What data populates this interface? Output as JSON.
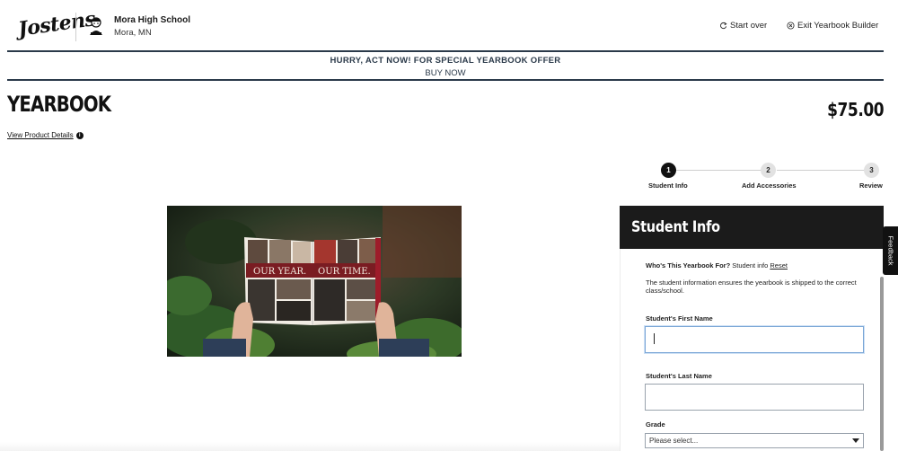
{
  "brand": {
    "logo_text": "Jostens"
  },
  "school": {
    "name": "Mora High School",
    "location": "Mora, MN"
  },
  "header_actions": {
    "start_over": "Start over",
    "exit_builder": "Exit Yearbook Builder"
  },
  "promo": {
    "headline": "HURRY, ACT NOW! FOR SPECIAL YEARBOOK OFFER",
    "link": "BUY NOW"
  },
  "product": {
    "title": "YEARBOOK",
    "price": "$75.00",
    "details_link": "View Product Details"
  },
  "stepper": {
    "steps": [
      {
        "number": "1",
        "label": "Student Info",
        "state": "active"
      },
      {
        "number": "2",
        "label": "Add Accessories",
        "state": "inactive"
      },
      {
        "number": "3",
        "label": "Review",
        "state": "inactive"
      }
    ]
  },
  "hero": {
    "page_text_left": "OUR YEAR.",
    "page_text_right": "OUR TIME."
  },
  "form": {
    "title": "Student Info",
    "who_question": "Who's This Yearbook For?",
    "who_value": "Student info",
    "reset": "Reset",
    "note": "The student information ensures the yearbook is shipped to the correct class/school.",
    "first_name_label": "Student's First Name",
    "first_name_value": "",
    "last_name_label": "Student's Last Name",
    "last_name_value": "",
    "grade_label": "Grade",
    "grade_selected": "Please select..."
  },
  "feedback": {
    "label": "Feedback"
  },
  "colors": {
    "accent_dark": "#1b1b1b",
    "banner_navy": "#2b3a4a",
    "focus_blue": "#7aa6d6"
  }
}
